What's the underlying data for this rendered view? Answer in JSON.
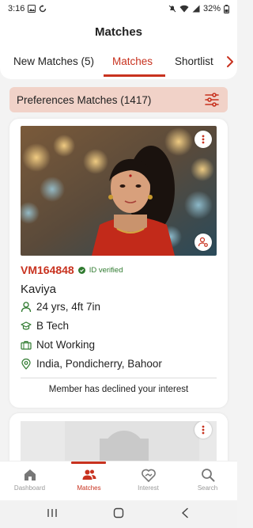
{
  "status_bar": {
    "time": "3:16",
    "battery": "32%"
  },
  "header": {
    "title": "Matches"
  },
  "tabs": [
    {
      "label": "New Matches (5)"
    },
    {
      "label": "Matches"
    },
    {
      "label": "Shortlist"
    }
  ],
  "preferences_bar": {
    "label": "Preferences Matches (1417)"
  },
  "card": {
    "profile_id": "VM164848",
    "verified_label": "ID verified",
    "name": "Kaviya",
    "age_height": "24 yrs, 4ft 7in",
    "education": "B Tech",
    "occupation": "Not Working",
    "location": "India, Pondicherry, Bahoor",
    "status_note": "Member has declined your interest"
  },
  "bottom_nav": [
    {
      "label": "Dashboard",
      "icon": "home-icon"
    },
    {
      "label": "Matches",
      "icon": "people-icon"
    },
    {
      "label": "Interest",
      "icon": "handshake-heart-icon"
    },
    {
      "label": "Search",
      "icon": "search-icon"
    }
  ],
  "colors": {
    "accent": "#c8321f",
    "preferences_bg": "#f1d2c8",
    "verified": "#2f7a2f"
  }
}
